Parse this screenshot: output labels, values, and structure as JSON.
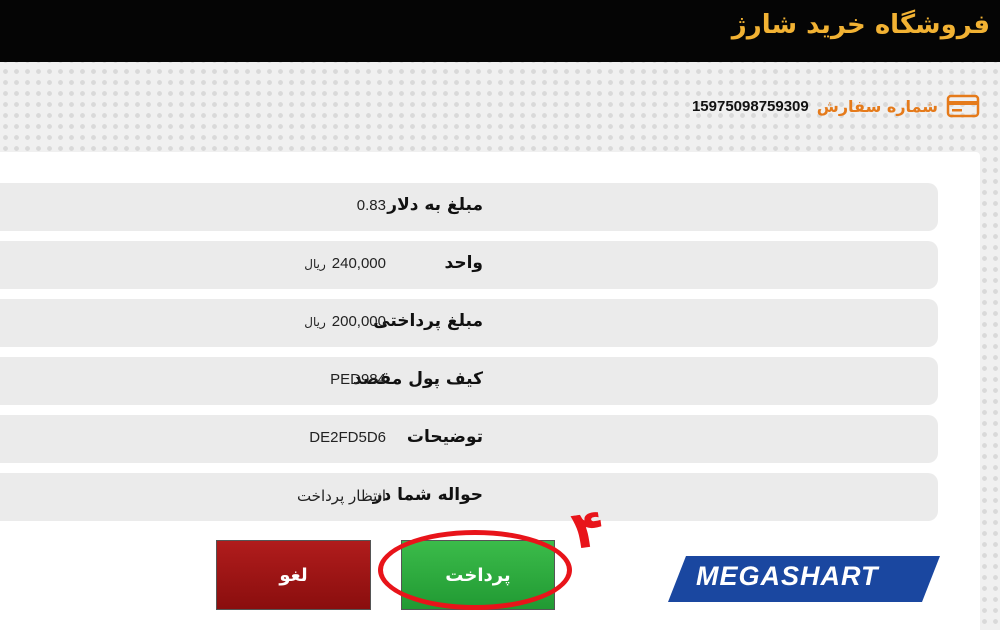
{
  "header": {
    "store_title": "فروشگاه خرید شارژ"
  },
  "order": {
    "icon": "credit-card-icon",
    "label": "شماره سفارش",
    "number": "15975098759309"
  },
  "details": {
    "rows": [
      {
        "label": "مبلغ به دلار",
        "value": "0.83",
        "unit": ""
      },
      {
        "label": "واحد",
        "value": "240,000",
        "unit": "ریال"
      },
      {
        "label": "مبلغ پرداختی",
        "value": "200,000",
        "unit": "ریال"
      },
      {
        "label": "کیف پول مقصد",
        "value": "PED984",
        "unit": ""
      },
      {
        "label": "توضیحات",
        "value": "DE2FD5D6",
        "unit": ""
      },
      {
        "label": "حواله شما در",
        "value": "انتظار پرداخت",
        "unit": ""
      }
    ]
  },
  "actions": {
    "cancel_label": "لغو",
    "pay_label": "پرداخت"
  },
  "annotation": {
    "step_number": "۴"
  },
  "brand": {
    "logo_text": "MEGASHART"
  },
  "colors": {
    "header_bg": "#050505",
    "title": "#f2b233",
    "order_label": "#e57a1a",
    "cancel": "#9b1515",
    "pay": "#2eaa3f",
    "highlight": "#e8141a",
    "logo_bg": "#1a47a0"
  }
}
